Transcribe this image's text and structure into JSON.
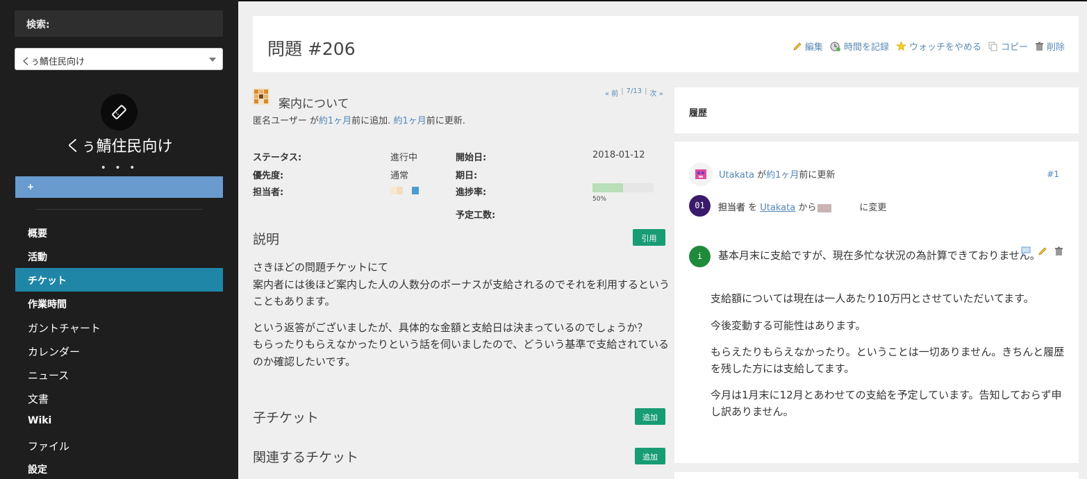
{
  "sidebar": {
    "search_label": "検索:",
    "project_select": "くぅ鯖住民向け",
    "project_name": "くぅ鯖住民向け",
    "more": "• • •",
    "new_label": "+",
    "menu": [
      {
        "label": "概要"
      },
      {
        "label": "活動"
      },
      {
        "label": "チケット",
        "active": true
      },
      {
        "label": "作業時間"
      },
      {
        "label": "ガントチャート"
      },
      {
        "label": "カレンダー"
      },
      {
        "label": "ニュース"
      },
      {
        "label": "文書"
      },
      {
        "label": "Wiki"
      },
      {
        "label": "ファイル"
      },
      {
        "label": "設定"
      }
    ]
  },
  "header": {
    "title": "問題 #206",
    "actions": {
      "edit": "編集",
      "log_time": "時間を記録",
      "unwatch": "ウォッチをやめる",
      "copy": "コピー",
      "delete": "削除"
    }
  },
  "issue": {
    "subject": "案内について",
    "pager": {
      "prev": "« 前",
      "position": "7/13",
      "next": "次 »"
    },
    "author": "匿名ユーザー",
    "author_mid": " が",
    "added_ago": "約1ヶ月",
    "added_suffix": "前に追加.",
    "updated_ago": "約1ヶ月",
    "updated_suffix": "前に更新.",
    "attributes": {
      "status_label": "ステータス:",
      "status": "進行中",
      "priority_label": "優先度:",
      "priority": "通常",
      "assignee_label": "担当者:",
      "start_label": "開始日:",
      "start": "2018-01-12",
      "due_label": "期日:",
      "due": "",
      "progress_label": "進捗率:",
      "progress": 50,
      "progress_text": "50%",
      "estimate_label": "予定工数:",
      "estimate": ""
    },
    "description_title": "説明",
    "quote_button": "引用",
    "description": [
      "さきほどの問題チケットにて\n案内者には後ほど案内した人の人数分のボーナスが支給されるのでそれを利用するということもあります。",
      "という返答がございましたが、具体的な金額と支給日は決まっているのでしょうか？\nもらったりもらえなかったりという話を伺いましたので、どういう基準で支給されているのか確認したいです。"
    ],
    "subtasks_title": "子チケット",
    "subtasks_add": "追加",
    "relations_title": "関連するチケット",
    "relations_add": "追加"
  },
  "history": {
    "title": "履歴",
    "journal": {
      "user": "Utakata",
      "mid": " が",
      "ago": "約1ヶ月",
      "suffix": "前に更新",
      "number": "#1",
      "detail_badge": "01",
      "detail_field": "担当者",
      "detail_wo": " を ",
      "detail_from_user": "Utakata",
      "detail_from": " から",
      "detail_to": "に変更",
      "note_badge": "i",
      "note_first": "基本月末に支給ですが、現在多忙な状況の為計算できておりません。",
      "note_paragraphs": [
        "支給額については現在は一人あたり10万円とさせていただいてます。",
        "今後変動する可能性はあります。",
        "もらえたりもらえなかったり。ということは一切ありません。きちんと履歴を残した方には支給してます。",
        "今月は1月末に12月とあわせての支給を予定しています。告知しておらず申し訳ありません。"
      ]
    }
  },
  "colors": {
    "sidebar_bg": "#1e1e1e",
    "active_menu": "#1f86a7",
    "new_button": "#6a9bcf",
    "green_button": "#179c73",
    "link": "#4f86b8",
    "progress_fill": "#b8dfb8"
  }
}
